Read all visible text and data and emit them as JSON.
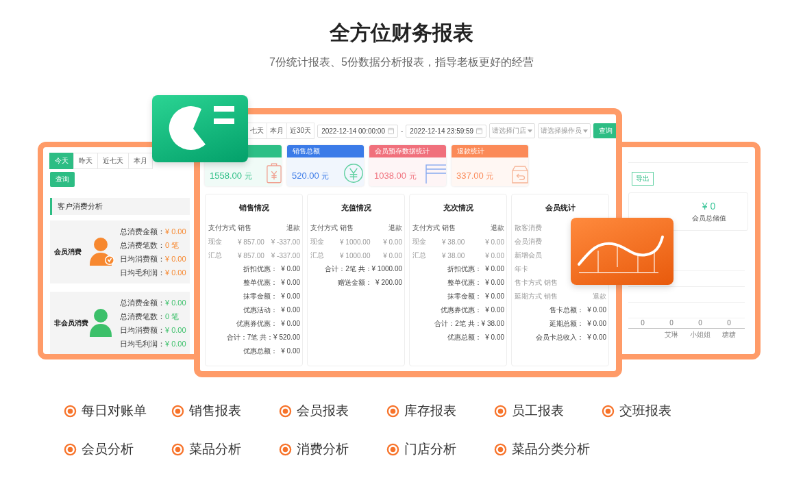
{
  "header": {
    "title": "全方位财务报表",
    "subtitle": "7份统计报表、5份数据分析报表，指导老板更好的经营"
  },
  "customer_panel": {
    "tabs": [
      {
        "label": "今天",
        "selected": true
      },
      {
        "label": "昨天",
        "selected": false
      },
      {
        "label": "近七天",
        "selected": false
      },
      {
        "label": "本月",
        "selected": false
      }
    ],
    "query_button": "查询",
    "section_title": "客户消费分析",
    "groups": [
      {
        "label": "会员消费",
        "kind": "member",
        "color": "#f7882f",
        "stats": [
          {
            "label": "总消费金额：",
            "value": "¥ 0.00"
          },
          {
            "label": "总消费笔数：",
            "value": "0 笔"
          },
          {
            "label": "日均消费额：",
            "value": "¥ 0.00"
          },
          {
            "label": "日均毛利润：",
            "value": "¥ 0.00"
          }
        ]
      },
      {
        "label": "非会员消费",
        "kind": "guest",
        "color": "#3cc06a",
        "stats": [
          {
            "label": "总消费金额：",
            "value": "¥ 0.00"
          },
          {
            "label": "总消费笔数：",
            "value": "0 笔"
          },
          {
            "label": "日均消费额：",
            "value": "¥ 0.00"
          },
          {
            "label": "日均毛利润：",
            "value": "¥ 0.00"
          }
        ]
      }
    ]
  },
  "report_panel": {
    "range_tabs": [
      {
        "label": "七天",
        "selected": false
      },
      {
        "label": "本月",
        "selected": false
      },
      {
        "label": "近30天",
        "selected": false
      }
    ],
    "start_time": "2022-12-14 00:00:00",
    "separator": "-",
    "end_time": "2022-12-14 23:59:59",
    "store_select": {
      "placeholder": "请选择门店"
    },
    "operator_select": {
      "placeholder": "请选择操作员"
    },
    "query_button": "查询",
    "summary_cards": [
      {
        "kind": "clipboard",
        "color": "#2dbf86",
        "value": "1558.00",
        "unit": "元"
      },
      {
        "kind": "yen-circle",
        "color": "#3b7be8",
        "title": "销售总额",
        "value": "520.00",
        "unit": "元"
      },
      {
        "kind": "vip-card",
        "color": "#f0707c",
        "title": "会员预存数据统计",
        "value": "1038.00",
        "unit": "元"
      },
      {
        "kind": "box-return",
        "color": "#fb8a58",
        "title": "退款统计",
        "value": "337.00",
        "unit": "元"
      }
    ],
    "tables": [
      {
        "title": "销售情况",
        "rows": [
          [
            "支付方式",
            "销售",
            "退款"
          ],
          [
            "现金",
            "¥ 857.00",
            "¥ -337.00"
          ],
          [
            "汇总",
            "¥ 857.00",
            "¥ -337.00"
          ]
        ],
        "totals": [
          "折扣优惠：  ¥ 0.00",
          "整单优惠：  ¥ 0.00",
          "抹零金额：  ¥ 0.00",
          "优惠活动：  ¥ 0.00",
          "优惠券优惠：  ¥ 0.00",
          "合计：7笔 共：¥ 520.00",
          "优惠总额：  ¥ 0.00"
        ]
      },
      {
        "title": "充值情况",
        "rows": [
          [
            "支付方式",
            "销售",
            "退款"
          ],
          [
            "现金",
            "¥ 1000.00",
            "¥ 0.00"
          ],
          [
            "汇总",
            "¥ 1000.00",
            "¥ 0.00"
          ]
        ],
        "totals": [
          "合计：2笔 共：¥ 1000.00",
          "赠送金额：  ¥ 200.00"
        ]
      },
      {
        "title": "充次情况",
        "rows": [
          [
            "支付方式",
            "销售",
            "退款"
          ],
          [
            "现金",
            "¥ 38.00",
            "¥ 0.00"
          ],
          [
            "汇总",
            "¥ 38.00",
            "¥ 0.00"
          ]
        ],
        "totals": [
          "折扣优惠：  ¥ 0.00",
          "整单优惠：  ¥ 0.00",
          "抹零金额：  ¥ 0.00",
          "优惠券优惠：  ¥ 0.00",
          "合计：2笔 共：¥ 38.00",
          "优惠总额：  ¥ 0.00"
        ]
      },
      {
        "title": "会员统计",
        "rows": [
          [
            "散客消费"
          ],
          [
            "会员消费"
          ],
          [
            "新增会员"
          ],
          [
            "年卡"
          ],
          [
            "售卡方式",
            "销售"
          ],
          [
            "延期方式",
            "销售",
            "退款"
          ]
        ],
        "totals": [
          "售卡总额：  ¥ 0.00",
          "延期总额：  ¥ 0.00",
          "会员卡总收入：  ¥ 0.00"
        ]
      }
    ]
  },
  "storage_panel": {
    "export_button": "导出",
    "total_value": "¥ 0",
    "total_label": "会员总储值",
    "columns": [
      {
        "value": "0"
      },
      {
        "value": "0",
        "label": "艾琳"
      },
      {
        "value": "0",
        "label": "小姐姐"
      },
      {
        "value": "0",
        "label": "糖糖"
      }
    ]
  },
  "features": [
    "每日对账单",
    "销售报表",
    "会员报表",
    "库存报表",
    "员工报表",
    "交班报表",
    "会员分析",
    "菜品分析",
    "消费分析",
    "门店分析",
    "菜品分类分析"
  ]
}
